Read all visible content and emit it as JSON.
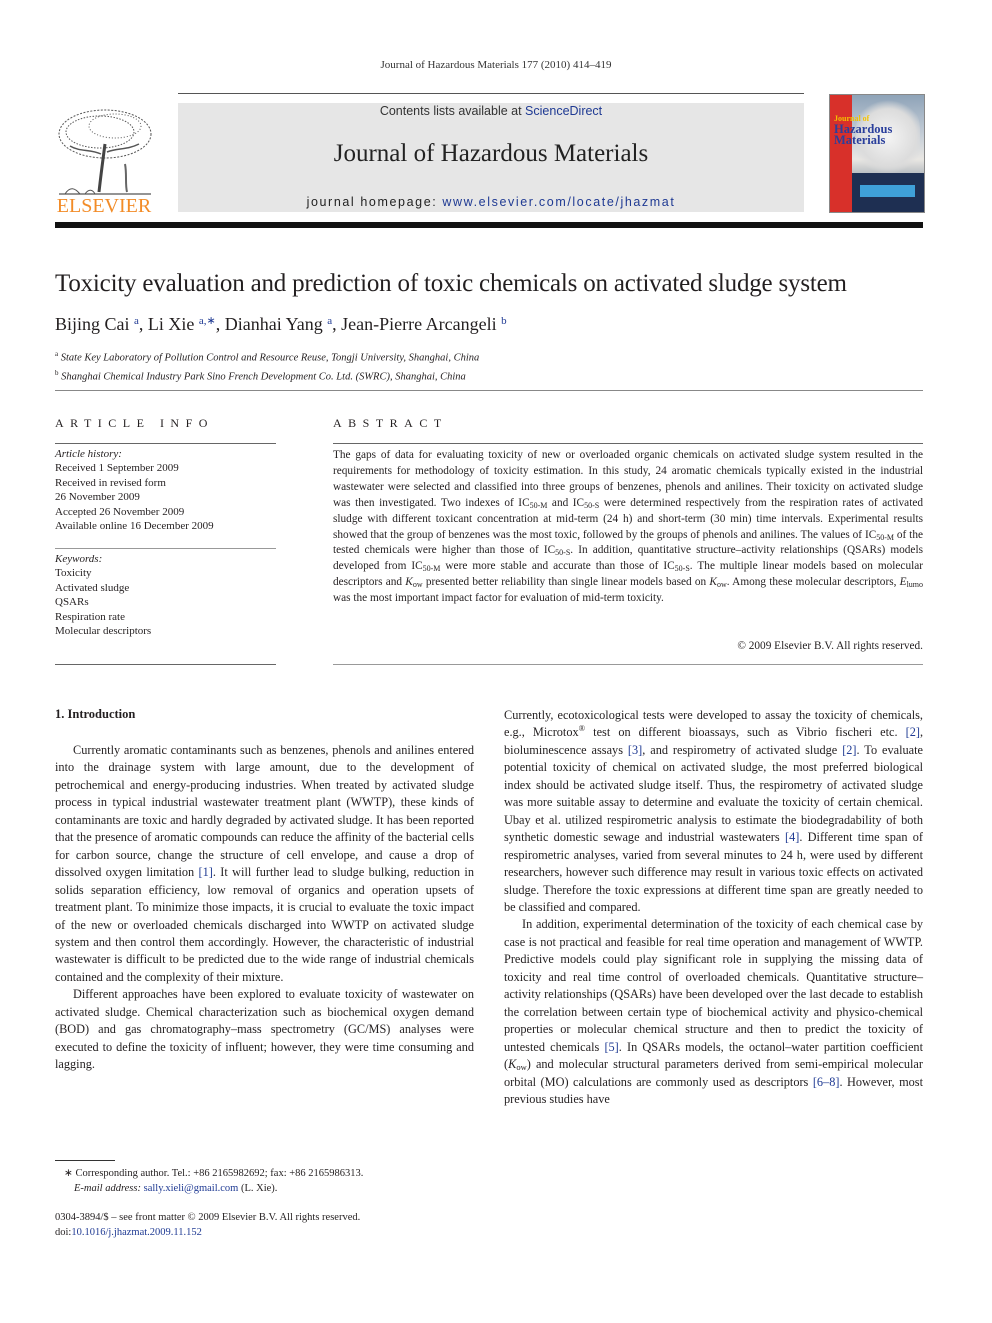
{
  "running_head": "Journal of Hazardous Materials 177 (2010) 414–419",
  "masthead": {
    "publisher_logo_text": "ELSEVIER",
    "contents_prefix": "Contents lists available at ",
    "contents_link": "ScienceDirect",
    "journal_title": "Journal of Hazardous Materials",
    "homepage_prefix": "journal homepage: ",
    "homepage_link": "www.elsevier.com/locate/jhazmat",
    "cover_line1": "Journal of",
    "cover_line2": "Hazardous",
    "cover_line3": "Materials"
  },
  "article": {
    "title": "Toxicity evaluation and prediction of toxic chemicals on activated sludge system",
    "authors": [
      {
        "name": "Bijing Cai",
        "aff": "a"
      },
      {
        "name": "Li Xie",
        "aff": "a,∗"
      },
      {
        "name": "Dianhai Yang",
        "aff": "a"
      },
      {
        "name": "Jean-Pierre Arcangeli",
        "aff": "b"
      }
    ],
    "affiliations": [
      {
        "mark": "a",
        "text": "State Key Laboratory of Pollution Control and Resource Reuse, Tongji University, Shanghai, China"
      },
      {
        "mark": "b",
        "text": "Shanghai Chemical Industry Park Sino French Development Co. Ltd. (SWRC), Shanghai, China"
      }
    ]
  },
  "article_info": {
    "heading": "ARTICLE INFO",
    "history_label": "Article history:",
    "history": [
      "Received 1 September 2009",
      "Received in revised form",
      "26 November 2009",
      "Accepted 26 November 2009",
      "Available online 16 December 2009"
    ],
    "keywords_label": "Keywords:",
    "keywords": [
      "Toxicity",
      "Activated sludge",
      "QSARs",
      "Respiration rate",
      "Molecular descriptors"
    ]
  },
  "abstract": {
    "heading": "ABSTRACT",
    "t1": "The gaps of data for evaluating toxicity of new or overloaded organic chemicals on activated sludge system resulted in the requirements for methodology of toxicity estimation. In this study, 24 aromatic chemicals typically existed in the industrial wastewater were selected and classified into three groups of benzenes, phenols and anilines. Their toxicity on activated sludge was then investigated. Two indexes of IC",
    "sub_m": "50-M",
    "t2": " and IC",
    "sub_s": "50-S",
    "t3": " were determined respectively from the respiration rates of activated sludge with different toxicant concentration at mid-term (24 h) and short-term (30 min) time intervals. Experimental results showed that the group of benzenes was the most toxic, followed by the groups of phenols and anilines. The values of IC",
    "t4": " of the tested chemicals were higher than those of IC",
    "t5": ". In addition, quantitative structure–activity relationships (QSARs) models developed from IC",
    "t6": " were more stable and accurate than those of IC",
    "t7": ". The multiple linear models based on molecular descriptors and ",
    "k": "K",
    "sub_ow": "ow",
    "t8": " presented better reliability than single linear models based on ",
    "t9": ". Among these molecular descriptors, ",
    "e": "E",
    "sub_lumo": "lumo",
    "t10": " was the most important impact factor for evaluation of mid-term toxicity.",
    "copyright": "© 2009 Elsevier B.V. All rights reserved."
  },
  "body": {
    "section_heading": "1.  Introduction",
    "p1a": "Currently aromatic contaminants such as benzenes, phenols and anilines entered into the drainage system with large amount, due to the development of petrochemical and energy-producing industries. When treated by activated sludge process in typical industrial wastewater treatment plant (WWTP), these kinds of contaminants are toxic and hardly degraded by activated sludge. It has been reported that the presence of aromatic compounds can reduce the affinity of the bacterial cells for carbon source, change the structure of cell envelope, and cause a drop of dissolved oxygen limitation ",
    "ref1": "[1]",
    "p1b": ". It will further lead to sludge bulking, reduction in solids separation efficiency, low removal of organics and operation upsets of treatment plant. To minimize those impacts, it is crucial to evaluate the toxic impact of the new or overloaded chemicals discharged into WWTP on activated sludge system and then control them accordingly. However, the characteristic of industrial wastewater is difficult to be predicted due to the wide range of industrial chemicals contained and the complexity of their mixture.",
    "p2": "Different approaches have been explored to evaluate toxicity of wastewater on activated sludge. Chemical characterization such as biochemical oxygen demand (BOD) and gas chromatography–mass spectrometry (GC/MS) analyses were executed to define the toxicity of influent; however, they were time consuming and lagging.",
    "p3a": "Currently, ecotoxicological tests were developed to assay the toxicity of chemicals, e.g., Microtox",
    "reg": "®",
    "p3b": " test on different bioassays, such as Vibrio fischeri etc. ",
    "ref2": "[2]",
    "p3c": ", bioluminescence assays ",
    "ref3": "[3]",
    "p3d": ", and respirometry of activated sludge ",
    "p3e": ". To evaluate potential toxicity of chemical on activated sludge, the most preferred biological index should be activated sludge itself. Thus, the respirometry of activated sludge was more suitable assay to determine and evaluate the toxicity of certain chemical. Ubay et al. utilized respirometric analysis to estimate the biodegradability of both synthetic domestic sewage and industrial wastewaters ",
    "ref4": "[4]",
    "p3f": ". Different time span of respirometric analyses, varied from several minutes to 24 h, were used by different researchers, however such difference may result in various toxic effects on activated sludge. Therefore the toxic expressions at different time span are greatly needed to be classified and compared.",
    "p4a": "In addition, experimental determination of the toxicity of each chemical case by case is not practical and feasible for real time operation and management of WWTP. Predictive models could play significant role in supplying the missing data of toxicity and real time control of overloaded chemicals. Quantitative structure–activity relationships (QSARs) have been developed over the last decade to establish the correlation between certain type of biochemical activity and physico-chemical properties or molecular chemical structure and then to predict the toxicity of untested chemicals ",
    "ref5": "[5]",
    "p4b": ". In QSARs models, the octanol–water partition coefficient (",
    "p4c": ") and molecular structural parameters derived from semi-empirical molecular orbital (MO) calculations are commonly used as descriptors ",
    "ref6": "[6–8]",
    "p4d": ". However, most previous studies have"
  },
  "footnotes": {
    "star": "∗",
    "corresponding": " Corresponding author. Tel.: +86 2165982692; fax: +86 2165986313.",
    "email_label": "E-mail address:",
    "email": "sally.xieli@gmail.com",
    "email_suffix": " (L. Xie).",
    "front_matter": "0304-3894/$ – see front matter © 2009 Elsevier B.V. All rights reserved.",
    "doi_label": "doi:",
    "doi": "10.1016/j.jhazmat.2009.11.152"
  }
}
